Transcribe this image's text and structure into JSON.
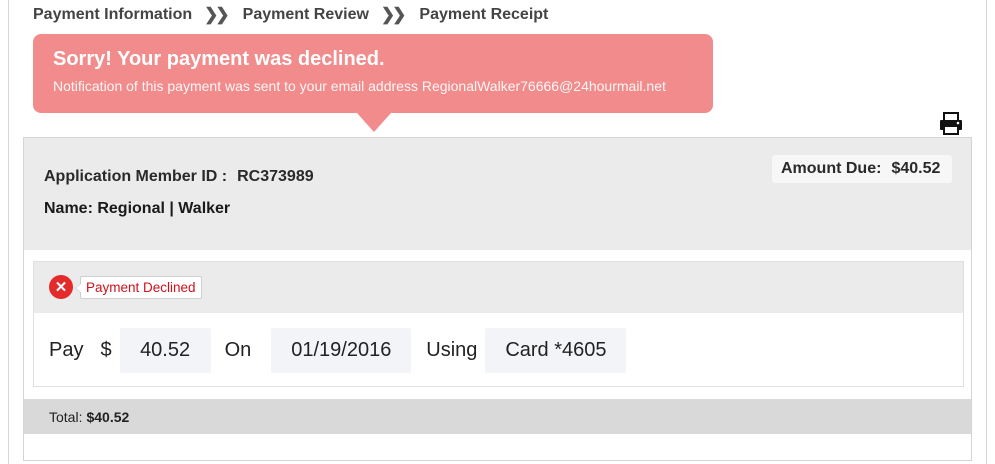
{
  "breadcrumb": {
    "steps": [
      "Payment Information",
      "Payment Review",
      "Payment Receipt"
    ],
    "separator": "❯❯"
  },
  "alert": {
    "title": "Sorry! Your payment was declined.",
    "message": "Notification of this payment was sent to your email address RegionalWalker76666@24hourmail.net",
    "color": "#f28b8b"
  },
  "toolbar": {
    "print_icon": "printer-icon"
  },
  "account": {
    "member_id_label": "Application Member ID :",
    "member_id": "RC373989",
    "name_text": "Name: Regional | Walker",
    "amount_due_label": "Amount Due:",
    "amount_due": "$40.52"
  },
  "status": {
    "icon": "x-circle-icon",
    "label": "Payment Declined",
    "color": "#d0101a"
  },
  "payment": {
    "pay_label": "Pay",
    "currency_symbol": "$",
    "amount": "40.52",
    "on_label": "On",
    "date": "01/19/2016",
    "using_label": "Using",
    "method": "Card *4605"
  },
  "total": {
    "label": "Total:",
    "value": "$40.52"
  }
}
